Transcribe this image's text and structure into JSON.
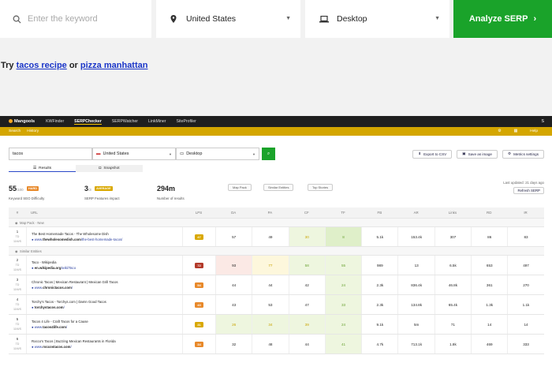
{
  "top": {
    "keyword_placeholder": "Enter the keyword",
    "location": "United States",
    "device": "Desktop",
    "analyze_label": "Analyze SERP",
    "try_prefix": "Try ",
    "try_link1": "tacos recipe",
    "try_or": " or ",
    "try_link2": "pizza manhattan"
  },
  "app": {
    "logo": "Mangools",
    "nav": [
      "KWFinder",
      "SERPChecker",
      "SERPWatcher",
      "LinkMiner",
      "SiteProfiler"
    ],
    "active_nav": "SERPChecker",
    "avatar": "S",
    "subnav": [
      "Search",
      "History"
    ],
    "help": "Help",
    "keyword": "tacos",
    "location": "United States",
    "device": "Desktop",
    "export_label": "Export to CSV",
    "save_label": "Save as image",
    "metrics_label": "Metrics settings",
    "tab_results": "Results",
    "tab_snapshot": "Snapshot",
    "kd_value": "55",
    "kd_max": "/100",
    "kd_badge": "HARD",
    "kd_label": "Keyword SEO Difficulty",
    "sf_value": "3",
    "sf_max": "/3",
    "sf_badge": "AVERAGE",
    "sf_label": "SERP Features impact",
    "results_value": "294m",
    "results_label": "Number of results",
    "chips": [
      "Map Pack",
      "Similar Entities",
      "Top Stories"
    ],
    "updated": "Last updated: 21 days ago",
    "refresh": "Refresh SERP",
    "columns": [
      "#",
      "URL",
      "LPS",
      "DA",
      "PA",
      "CF",
      "TF",
      "FB",
      "AR",
      "Links",
      "RD",
      "IR"
    ],
    "section_map": "Map Pack",
    "section_map_sub": "· New",
    "section_similar": "Similar Entities",
    "rows": [
      {
        "rank": "1",
        "d1": "TD",
        "d2": "11M/S",
        "title": "The Best Homemade Tacos - The Wholesome Dish",
        "url_pre": "www.",
        "url_host": "thewholesomedish.com",
        "url_path": "/the-best-homemade-tacos/",
        "lps": "47",
        "lps_color": "#d9a800",
        "da": "57",
        "pa": "49",
        "cf": "30",
        "tf": "8",
        "fb": "5.1k",
        "ar": "153.4k",
        "links": "307",
        "rd": "86",
        "ir": "83"
      },
      {
        "rank": "2",
        "d1": "TD",
        "d2": "11M/S",
        "title": "Taco - Wikipedia",
        "url_pre": "",
        "url_host": "en.wikipedia.org",
        "url_path": "/wiki/Taco",
        "lps": "72",
        "lps_color": "#b33a2a",
        "da": "93",
        "pa": "77",
        "cf": "58",
        "tf": "55",
        "fb": "989",
        "ar": "13",
        "links": "6.5k",
        "rd": "653",
        "ir": "497"
      },
      {
        "rank": "3",
        "d1": "TD",
        "d2": "11M/S",
        "title": "Chronic Tacos | Mexican Restaurant | Mexican Grill Tacos",
        "url_pre": "www.",
        "url_host": "chronictacos.com",
        "url_path": "/",
        "lps": "54",
        "lps_color": "#e8892a",
        "da": "44",
        "pa": "44",
        "cf": "42",
        "tf": "24",
        "fb": "2.3k",
        "ar": "836.4k",
        "links": "46.8k",
        "rd": "361",
        "ir": "270"
      },
      {
        "rank": "4",
        "d1": "TD",
        "d2": "11M/S",
        "title": "Torchy's Tacos - Torchys.com | Damn Good Tacos",
        "url_pre": "",
        "url_host": "torchystacos.com",
        "url_path": "/",
        "lps": "43",
        "lps_color": "#e8892a",
        "da": "43",
        "pa": "53",
        "cf": "47",
        "tf": "33",
        "fb": "2.3k",
        "ar": "134.8k",
        "links": "65.4k",
        "rd": "1.3k",
        "ir": "1.1k"
      },
      {
        "rank": "5",
        "d1": "TD",
        "d2": "11M/S",
        "title": "Tacos 4 Life - Craft Tacos for a Cause",
        "url_pre": "www.",
        "url_host": "tacos4life.com",
        "url_path": "/",
        "lps": "31",
        "lps_color": "#d9a800",
        "da": "26",
        "pa": "34",
        "cf": "39",
        "tf": "24",
        "fb": "9.1k",
        "ar": "5m",
        "links": "71",
        "rd": "14",
        "ir": "14"
      },
      {
        "rank": "6",
        "d1": "TD",
        "d2": "11M/S",
        "title": "Rocco's Tacos | Buzzing Mexican Restaurants in Florida",
        "url_pre": "www.",
        "url_host": "roccostacos.com",
        "url_path": "/",
        "lps": "34",
        "lps_color": "#e8892a",
        "da": "32",
        "pa": "48",
        "cf": "44",
        "tf": "41",
        "fb": "4.7k",
        "ar": "713.1k",
        "links": "1.8k",
        "rd": "469",
        "ir": "333"
      }
    ]
  }
}
